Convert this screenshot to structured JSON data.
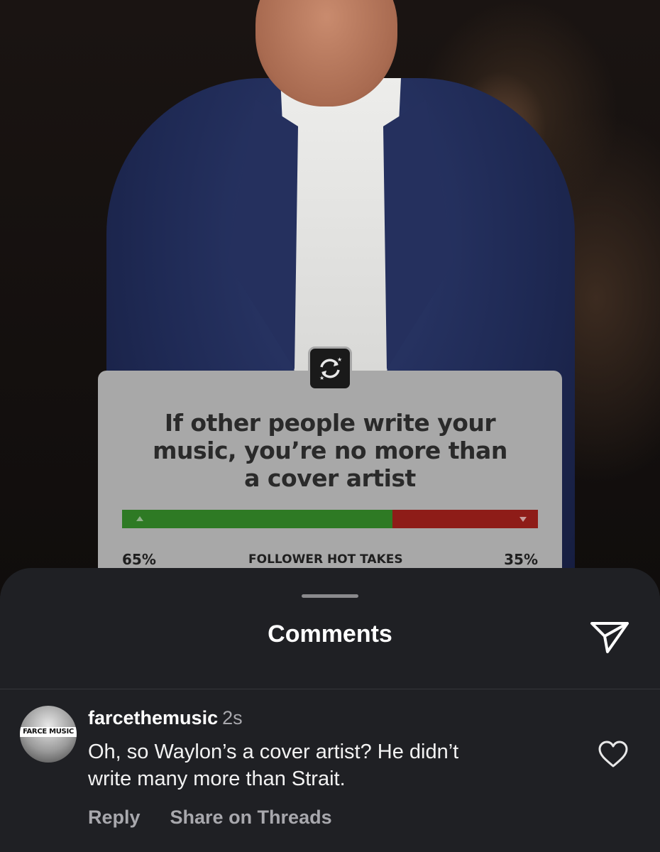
{
  "poll": {
    "question": "If other people write your\nmusic, you’re no more than\na cover artist",
    "yes_percent": 65,
    "no_percent": 35,
    "left_label": "65%",
    "center_label": "FOLLOWER HOT TAKES",
    "right_label": "35%",
    "yes_color": "#2e7a24",
    "no_color": "#8e1c18",
    "logo_icon": "swap-arrows-logo-icon"
  },
  "sheet": {
    "title": "Comments",
    "share_icon": "paper-plane-icon"
  },
  "comment": {
    "avatar_text": "FARCE MUSIC",
    "username": "farcethemusic",
    "time": "2s",
    "text": "Oh, so Waylon’s a cover artist? He didn’t\nwrite many more than Strait.",
    "like_icon": "heart-icon",
    "reply_label": "Reply",
    "share_threads_label": "Share on Threads"
  }
}
